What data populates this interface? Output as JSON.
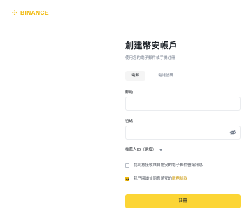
{
  "brand": {
    "name": "BINANCE",
    "color": "#f0b90b"
  },
  "form": {
    "title": "創建幣安帳戶",
    "subtitle": "使用您的電子郵件或手機註冊",
    "tabs": [
      {
        "label": "電郵",
        "active": true
      },
      {
        "label": "電話號碼",
        "active": false
      }
    ],
    "email": {
      "label": "郵箱",
      "value": "",
      "placeholder": ""
    },
    "password": {
      "label": "密碼",
      "value": "",
      "placeholder": "",
      "visibility_icon": "eye-off-icon"
    },
    "referral": {
      "label": "推薦人ID（選填）",
      "icon": "chevron-down-icon"
    },
    "consent_marketing": {
      "label": "我同意接收來自幣安的電子郵件營銷訊息",
      "checked": false
    },
    "consent_terms": {
      "label_prefix": "我已閱讀並同意幣安的",
      "link_label": "服務條款",
      "checked": true
    },
    "submit_label": "註冊"
  },
  "colors": {
    "accent": "#fcd535",
    "link": "#c99400",
    "border": "#eaecef",
    "text": "#1e2329",
    "muted": "#707a8a"
  }
}
